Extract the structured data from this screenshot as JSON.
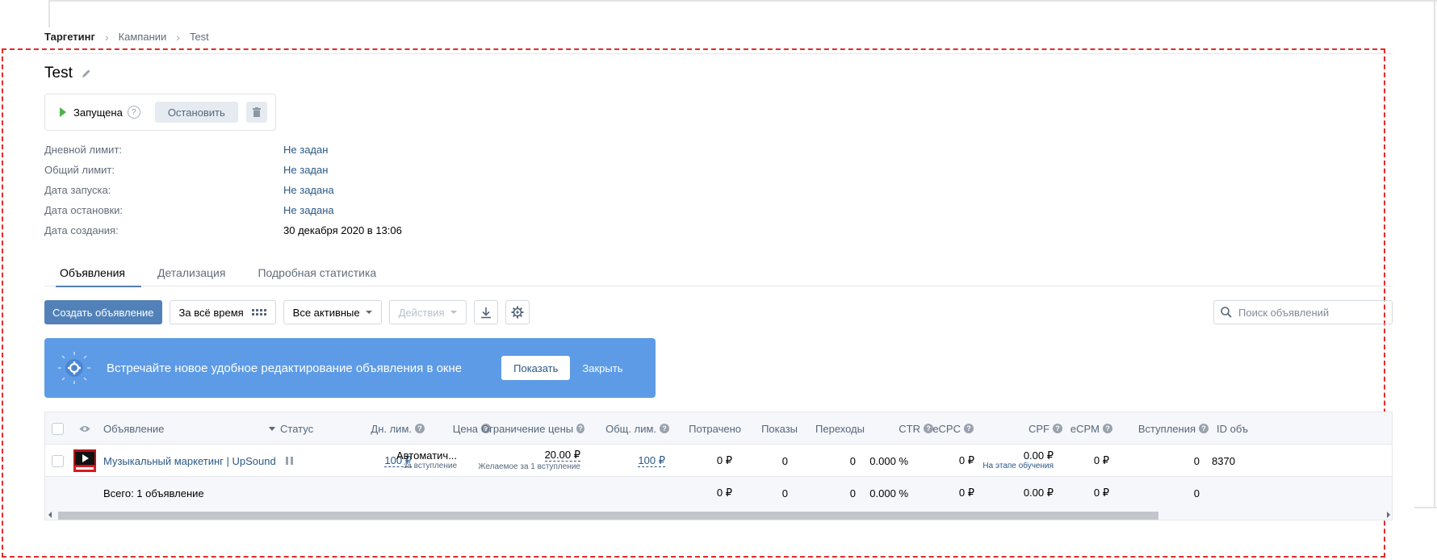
{
  "breadcrumb": {
    "root": "Таргетинг",
    "item1": "Кампании",
    "item2": "Test"
  },
  "campaign": {
    "title": "Test"
  },
  "status_box": {
    "status": "Запущена",
    "help": "?",
    "stop_label": "Остановить"
  },
  "info": [
    {
      "label": "Дневной лимит:",
      "value": "Не задан"
    },
    {
      "label": "Общий лимит:",
      "value": "Не задан"
    },
    {
      "label": "Дата запуска:",
      "value": "Не задана"
    },
    {
      "label": "Дата остановки:",
      "value": "Не задана"
    },
    {
      "label": "Дата создания:",
      "value": "30 декабря 2020 в 13:06"
    }
  ],
  "tabs": [
    {
      "label": "Объявления",
      "active": true
    },
    {
      "label": "Детализация",
      "active": false
    },
    {
      "label": "Подробная статистика",
      "active": false
    }
  ],
  "toolbar": {
    "create_label": "Создать объявление",
    "period_label": "За всё время",
    "filter_label": "Все активные",
    "actions_label": "Действия",
    "search_placeholder": "Поиск объявлений"
  },
  "banner": {
    "text": "Встречайте новое удобное редактирование объявления в окне",
    "show_label": "Показать",
    "close_label": "Закрыть",
    "color": "#5d9be6"
  },
  "table": {
    "headers": {
      "ad": "Объявление",
      "status": "Статус",
      "day_limit": "Дн. лим.",
      "price": "Цена",
      "price_limit": "Ограничение цены",
      "total_limit": "Общ. лим.",
      "spent": "Потрачено",
      "impressions": "Показы",
      "clicks": "Переходы",
      "ctr": "CTR",
      "ecpc": "eCPC",
      "cpf": "CPF",
      "ecpm": "eCPM",
      "joins": "Вступления",
      "id": "ID объ"
    },
    "row": {
      "name": "Музыкальный маркетинг | UpSound",
      "day_limit": "100 ₽",
      "price_main": "Автоматич...",
      "price_sub": "за вступление",
      "price_limit_main": "20.00 ₽",
      "price_limit_sub": "Желаемое за 1 вступление",
      "total_limit": "100 ₽",
      "spent": "0 ₽",
      "impressions": "0",
      "clicks": "0",
      "ctr": "0.000 %",
      "ecpc": "0 ₽",
      "cpf_main": "0.00 ₽",
      "cpf_sub": "На этапе обучения",
      "ecpm": "0 ₽",
      "joins": "0",
      "id": "8370"
    },
    "total": {
      "label": "Всего: 1 объявление",
      "spent": "0 ₽",
      "impressions": "0",
      "clicks": "0",
      "ctr": "0.000 %",
      "ecpc": "0 ₽",
      "cpf": "0.00 ₽",
      "ecpm": "0 ₽",
      "joins": "0"
    }
  },
  "colors": {
    "accent": "#5181b8",
    "link": "#2a5885",
    "frame": "#e22b2b",
    "running": "#4bb34b"
  }
}
